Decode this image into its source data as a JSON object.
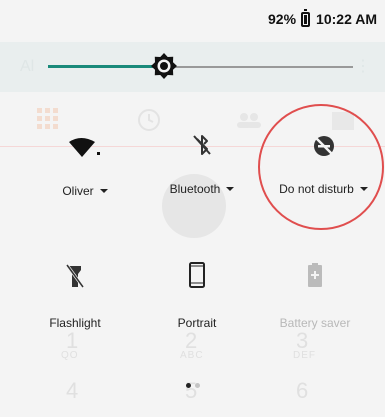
{
  "status_bar": {
    "battery_percent": "92%",
    "time": "10:22 AM"
  },
  "brightness": {
    "level": 0.38,
    "accent_color": "#1a8a7a"
  },
  "tiles_row1": [
    {
      "id": "wifi",
      "label": "Oliver",
      "icon": "wifi-icon",
      "has_dropdown": true
    },
    {
      "id": "bluetooth",
      "label": "Bluetooth",
      "icon": "bluetooth-off-icon",
      "has_dropdown": true
    },
    {
      "id": "dnd",
      "label": "Do not disturb",
      "icon": "do-not-disturb-icon",
      "has_dropdown": true
    }
  ],
  "tiles_row2": [
    {
      "id": "flashlight",
      "label": "Flashlight",
      "icon": "flashlight-off-icon",
      "disabled": false
    },
    {
      "id": "rotation",
      "label": "Portrait",
      "icon": "portrait-icon",
      "disabled": false
    },
    {
      "id": "battery_saver",
      "label": "Battery saver",
      "icon": "battery-saver-icon",
      "disabled": true
    }
  ],
  "highlight_color": "#e04e4e",
  "pages": {
    "current": 1,
    "total": 2
  }
}
